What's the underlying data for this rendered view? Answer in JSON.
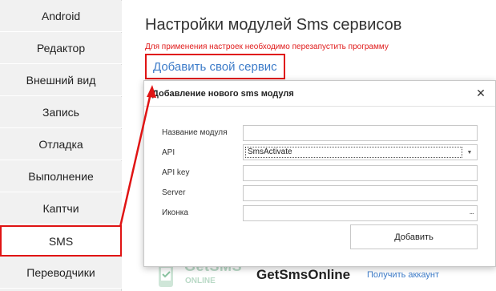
{
  "sidebar": {
    "items": [
      {
        "label": "Android",
        "active": false
      },
      {
        "label": "Редактор",
        "active": false
      },
      {
        "label": "Внешний вид",
        "active": false
      },
      {
        "label": "Запись",
        "active": false
      },
      {
        "label": "Отладка",
        "active": false
      },
      {
        "label": "Выполнение",
        "active": false
      },
      {
        "label": "Каптчи",
        "active": false
      },
      {
        "label": "SMS",
        "active": true
      },
      {
        "label": "Переводчики",
        "active": false
      }
    ]
  },
  "main": {
    "title": "Настройки модулей Sms сервисов",
    "restart_note": "Для применения настроек необходимо перезапустить программу",
    "add_service_label": "Добавить свой сервис"
  },
  "modal": {
    "title": "Добавление нового sms модуля",
    "close_icon": "close-icon",
    "fields": {
      "module_name": {
        "label": "Название модуля",
        "value": ""
      },
      "api": {
        "label": "API",
        "value": "SmsActivate"
      },
      "api_key": {
        "label": "API key",
        "value": ""
      },
      "server": {
        "label": "Server",
        "value": ""
      },
      "icon": {
        "label": "Иконка",
        "value": "",
        "browse": "..."
      }
    },
    "submit_label": "Добавить"
  },
  "background_card": {
    "logo_text": "GetSMS",
    "logo_sub": "ONLINE",
    "name": "GetSmsOnline",
    "link": "Получить аккаунт"
  },
  "colors": {
    "accent": "#3d7cc9",
    "highlight": "#e01414",
    "warning_text": "#e01b1b"
  }
}
